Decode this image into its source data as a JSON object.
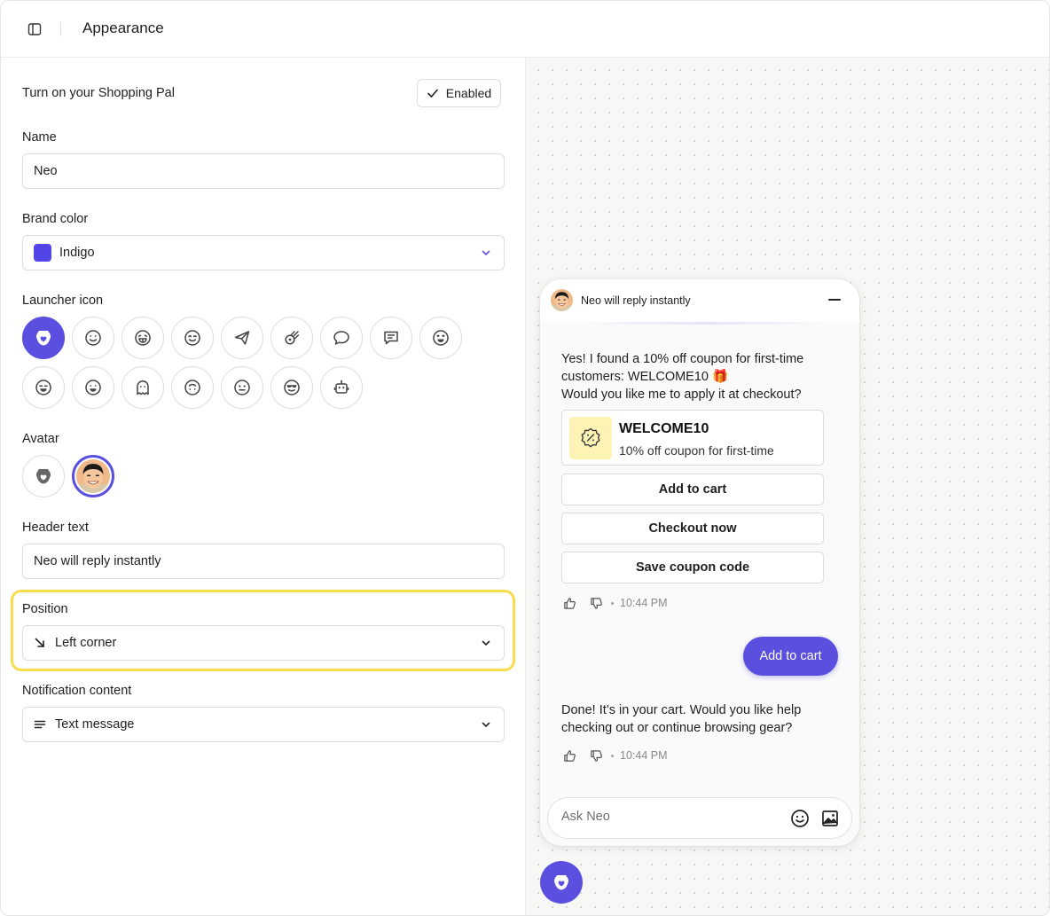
{
  "header": {
    "title": "Appearance"
  },
  "settings": {
    "toggle": {
      "label": "Turn on your Shopping Pal",
      "button": "Enabled"
    },
    "name": {
      "label": "Name",
      "value": "Neo"
    },
    "brand_color": {
      "label": "Brand color",
      "value": "Indigo",
      "color": "#5145e8"
    },
    "launcher_icon": {
      "label": "Launcher icon",
      "icons": [
        "bag-heart-icon",
        "smile-icon",
        "laugh-icon",
        "grin-icon",
        "paper-plane-icon",
        "comet-icon",
        "speech-bubble-icon",
        "message-lines-icon",
        "heart-eyes-icon",
        "squint-smile-icon",
        "beam-icon",
        "ghost-icon",
        "upside-smile-icon",
        "neutral-icon",
        "sunglasses-icon",
        "robot-icon"
      ]
    },
    "avatar": {
      "label": "Avatar",
      "options": [
        "bag-heart-icon",
        "person-photo"
      ]
    },
    "header_text": {
      "label": "Header text",
      "value": "Neo will reply instantly"
    },
    "position": {
      "label": "Position",
      "value": "Left corner",
      "icon": "arrow-down-right-icon"
    },
    "notification": {
      "label": "Notification content",
      "value": "Text message",
      "icon": "lines-icon"
    }
  },
  "preview": {
    "header_title": "Neo will reply instantly",
    "bot_message_1": {
      "line1": "Yes! I found a 10% off coupon for first-time",
      "line2": "customers: WELCOME10 🎁",
      "line3": "Would you like me to apply it at checkout?"
    },
    "coupon": {
      "code": "WELCOME10",
      "description": "10% off coupon for first-time"
    },
    "quick_replies": [
      "Add to cart",
      "Checkout now",
      "Save coupon code"
    ],
    "timestamp_1": "10:44 PM",
    "user_message": "Add to cart",
    "bot_message_2": {
      "line1": "Done! It’s in your cart. Would you like help",
      "line2": "checking out or continue browsing gear?"
    },
    "timestamp_2": "10:44 PM",
    "composer_placeholder": "Ask Neo"
  },
  "colors": {
    "accent": "#5b4fe0",
    "highlight": "#f8dc4b",
    "coupon_bg": "#fdf3b5"
  }
}
